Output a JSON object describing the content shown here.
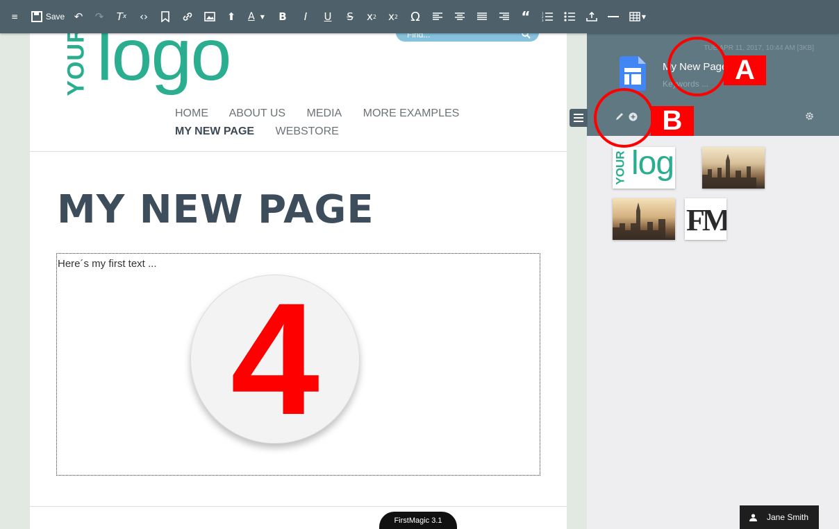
{
  "toolbar": {
    "save_label": "Save"
  },
  "header": {
    "logo_your": "YOUR",
    "logo_text": "logo",
    "search_placeholder": "Find..."
  },
  "nav": {
    "items": [
      "HOME",
      "ABOUT US",
      "MEDIA",
      "MORE EXAMPLES",
      "MY NEW PAGE",
      "WEBSTORE"
    ],
    "active": "MY NEW PAGE"
  },
  "content": {
    "title": "MY NEW PAGE",
    "first_text": "Here´s my first text ...",
    "step_number": "4"
  },
  "footer": {
    "version": "FirstMagic 3.1"
  },
  "panel": {
    "date": "TUE APR 11, 2017, 10:44 AM [3KB]",
    "page_name": "My New Page",
    "keywords_placeholder": "Keywords ...",
    "thumb_logo_your": "YOUR",
    "thumb_logo_text": "logo",
    "thumb_fm_text": "FM"
  },
  "user": {
    "name": "Jane Smith"
  },
  "annotations": {
    "a_label": "A",
    "b_label": "B"
  },
  "colors": {
    "toolbar": "#4e616a",
    "panel_header": "#5f7882",
    "logo": "#2aae8f",
    "annotation": "#ff0000"
  }
}
